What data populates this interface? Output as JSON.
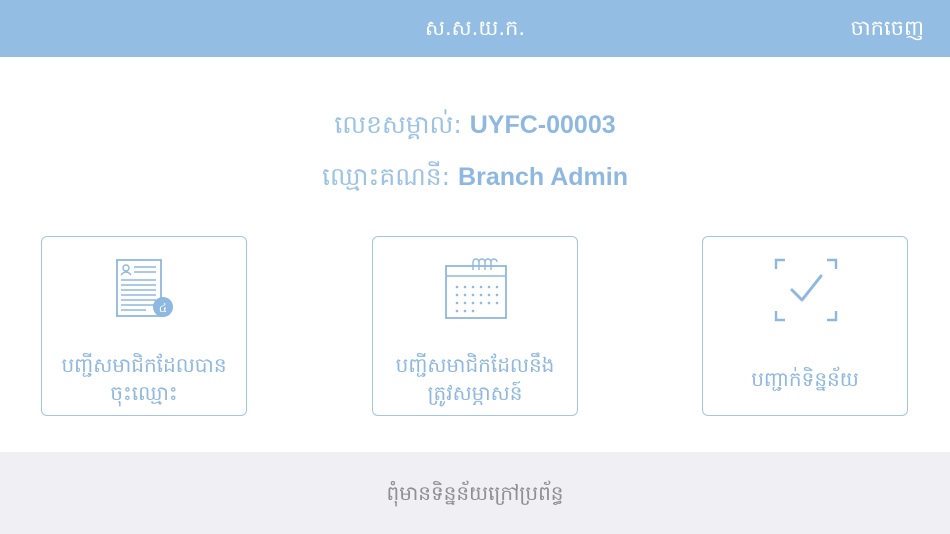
{
  "header": {
    "title": "ស.ស.យ.ក.",
    "logout_label": "ចាកចេញ"
  },
  "account": {
    "id_label": "លេខសម្គាល់:",
    "id_value": "UYFC-00003",
    "name_label": "ឈ្មោះគណនី:",
    "name_value": "Branch Admin"
  },
  "cards": [
    {
      "label_line1": "បញ្ជីសមាជិកដែលបាន",
      "label_line2": "ចុះឈ្មោះ",
      "icon": "registered-list-icon"
    },
    {
      "label_line1": "បញ្ជីសមាជិកដែលនឹង",
      "label_line2": "ត្រូវសម្ភាសន៍",
      "icon": "calendar-icon"
    },
    {
      "label_line1": "បញ្ជាក់ទិន្នន័យ",
      "icon": "verify-check-icon"
    }
  ],
  "footer": {
    "status_text": "ពុំមានទិន្នន័យក្រៅប្រព័ន្ធ"
  },
  "colors": {
    "header_bg": "#93bde3",
    "accent": "#8fb8e0",
    "footer_bg": "#efeff4",
    "footer_text": "#8e8e93"
  }
}
